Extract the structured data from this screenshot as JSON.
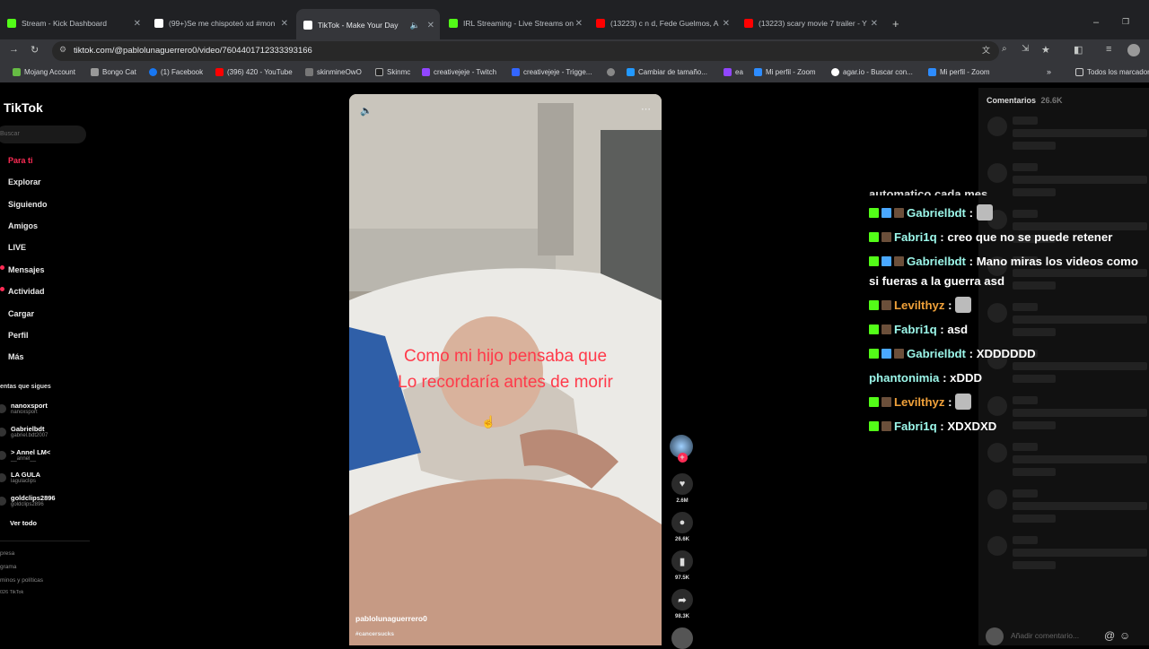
{
  "browser": {
    "tabs": [
      {
        "title": "Stream - Kick Dashboard",
        "color": "#53fc18"
      },
      {
        "title": "(99+)Se me chispoteó xd #mon",
        "color": "#fff"
      },
      {
        "title": "TikTok - Make Your Day",
        "color": "#fff"
      },
      {
        "title": "IRL Streaming - Live Streams on",
        "color": "#53fc18"
      },
      {
        "title": "(13223) c n d, Fede Guelmos, A",
        "color": "#ff0000"
      },
      {
        "title": "(13223) scary movie 7 trailer - Y",
        "color": "#ff0000"
      }
    ],
    "url": "tiktok.com/@pablolunaguerrero0/video/7604401712333393166",
    "bookmarks": [
      "Mojang Account",
      "Bongo Cat",
      "(1) Facebook",
      "(396) 420 - YouTube",
      "skinmineOwO",
      "Skinmc",
      "creativejeje - Twitch",
      "creativejeje - Trigge...",
      "",
      "Cambiar de tamaño...",
      "ea",
      "Mi perfil - Zoom",
      "agar.io - Buscar con...",
      "Mi perfil - Zoom"
    ],
    "all_bookmarks": "Todos los marcadores"
  },
  "tiktok": {
    "logo": "TikTok",
    "search_placeholder": "Buscar",
    "nav": [
      "Para ti",
      "Explorar",
      "Siguiendo",
      "Amigos",
      "LIVE",
      "Mensajes",
      "Actividad",
      "Cargar",
      "Perfil",
      "Más"
    ],
    "following_title": "entas que sigues",
    "following": [
      {
        "name": "nanoxsport",
        "user": "nanoxsport"
      },
      {
        "name": "Gabrielbdt",
        "user": "gabriel.bdt2007"
      },
      {
        "name": "> Annel LM<",
        "user": "__annel__"
      },
      {
        "name": "LA GULA",
        "user": "lagulaclips"
      },
      {
        "name": "goldclips2896",
        "user": "goldclips2896"
      }
    ],
    "see_all": "Ver todo",
    "footer": [
      "presa",
      "grama",
      "minos y políticas",
      "026 TikTok"
    ],
    "video": {
      "caption_line1": "Como mi hijo pensaba que",
      "caption_line2": "Lo recordaría antes de morir",
      "author": "pablolunaguerrero0",
      "tag": "#cancersucks"
    },
    "actions": {
      "likes": "2.6M",
      "comments": "26.6K",
      "saves": "97.5K",
      "shares": "98.3K"
    },
    "comments_title": "Comentarios",
    "comments_count": "26.6K",
    "comment_placeholder": "Añadir comentario..."
  },
  "chat": [
    {
      "user": "Gabrielbdt",
      "color": "#9cf7ea",
      "text": ""
    },
    {
      "user": "Fabri1q",
      "color": "#9cf7ea",
      "text": "creo que no se puede retener"
    },
    {
      "user": "Gabrielbdt",
      "color": "#9cf7ea",
      "text": "Mano miras los videos como si fueras a la guerra asd"
    },
    {
      "user": "Levilthyz",
      "color": "#f0a13a",
      "text": ""
    },
    {
      "user": "Fabri1q",
      "color": "#9cf7ea",
      "text": "asd"
    },
    {
      "user": "Gabrielbdt",
      "color": "#9cf7ea",
      "text": "XDDDDDD"
    },
    {
      "user": "phantonimia",
      "color": "#9cf7ea",
      "text": "xDDD"
    },
    {
      "user": "Levilthyz",
      "color": "#f0a13a",
      "text": ""
    },
    {
      "user": "Fabri1q",
      "color": "#9cf7ea",
      "text": "XDXDXD"
    }
  ]
}
